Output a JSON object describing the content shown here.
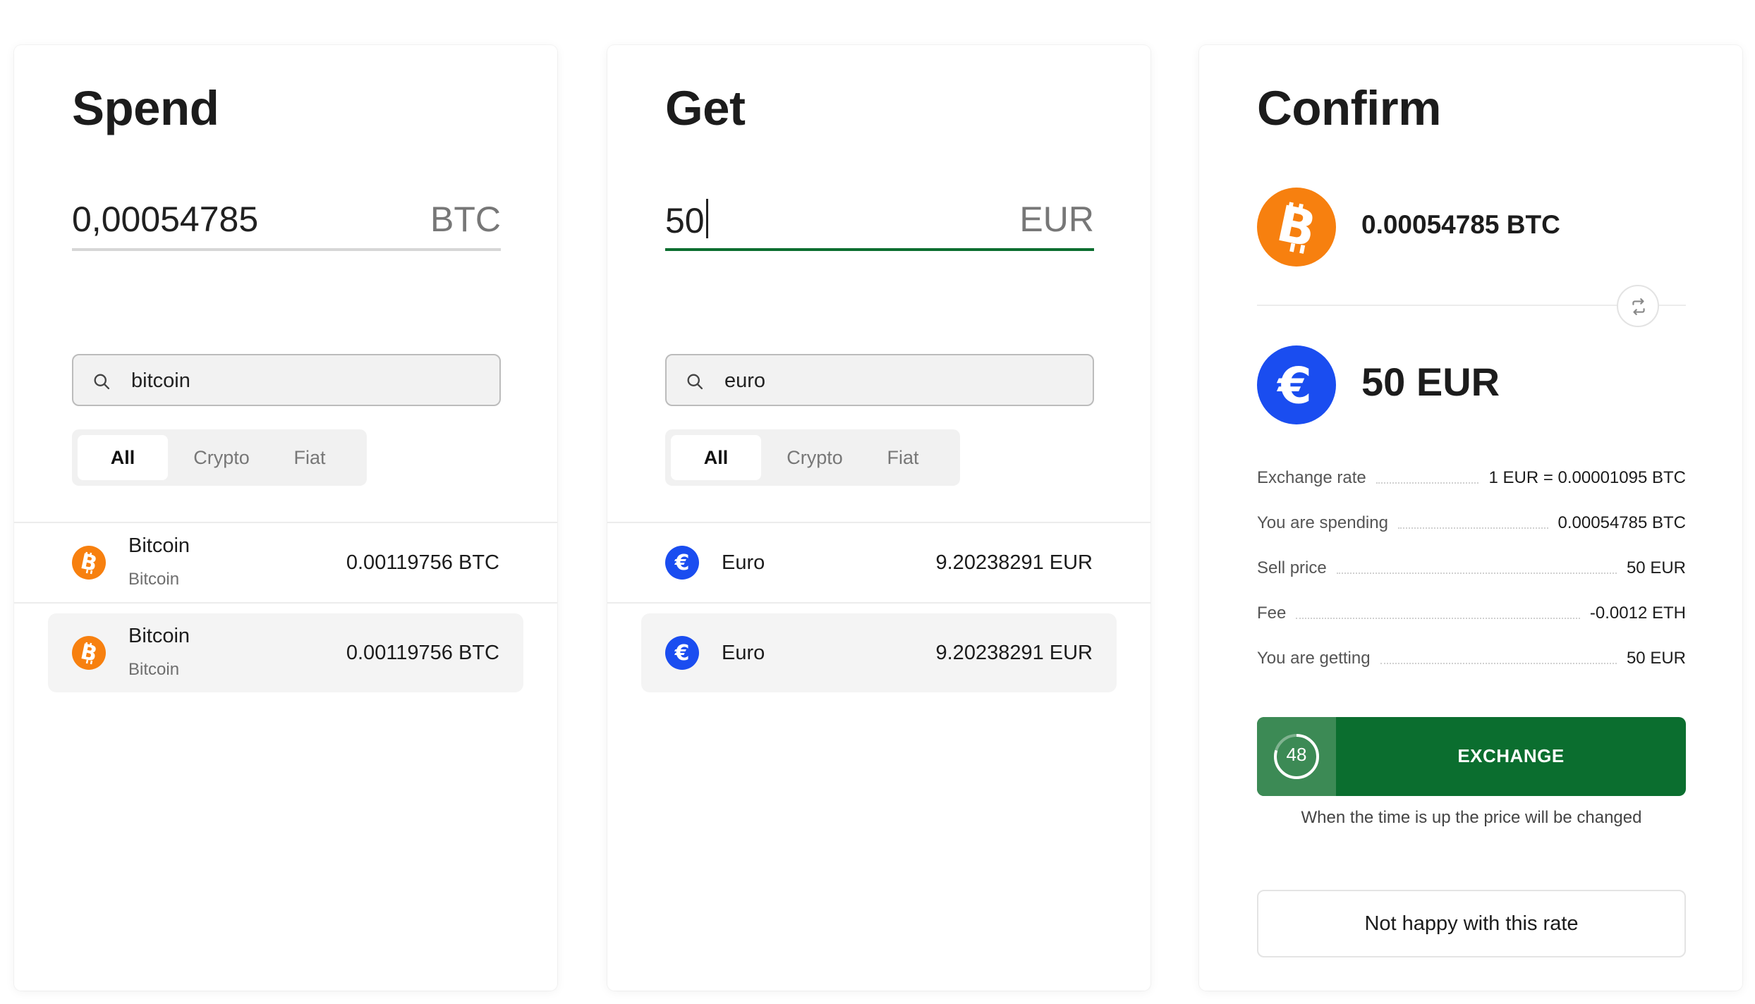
{
  "colors": {
    "accent_green": "#0b6e2f",
    "timer_green": "#3c8a55",
    "bitcoin_orange": "#f7800f",
    "euro_blue": "#1a4df0"
  },
  "spend": {
    "title": "Spend",
    "amount": "0,00054785",
    "currency": "BTC",
    "search_value": "bitcoin",
    "search_icon": "search-icon",
    "tabs": [
      "All",
      "Crypto",
      "Fiat"
    ],
    "active_tab": "All",
    "results": [
      {
        "name": "Bitcoin",
        "subtitle": "Bitcoin",
        "amount": "0.00119756 BTC",
        "icon": "bitcoin-icon"
      },
      {
        "name": "Bitcoin",
        "subtitle": "Bitcoin",
        "amount": "0.00119756 BTC",
        "icon": "bitcoin-icon"
      }
    ]
  },
  "get": {
    "title": "Get",
    "amount": "50",
    "currency": "EUR",
    "search_value": "euro",
    "search_icon": "search-icon",
    "tabs": [
      "All",
      "Crypto",
      "Fiat"
    ],
    "active_tab": "All",
    "results": [
      {
        "name": "Euro",
        "amount": "9.20238291 EUR",
        "icon": "euro-icon"
      },
      {
        "name": "Euro",
        "amount": "9.20238291 EUR",
        "icon": "euro-icon"
      }
    ]
  },
  "confirm": {
    "title": "Confirm",
    "from_amount": "0.00054785 BTC",
    "from_icon": "bitcoin-icon",
    "to_amount": "50 EUR",
    "to_icon": "euro-icon",
    "swap_icon": "swap-icon",
    "details": [
      {
        "label": "Exchange rate",
        "value": "1 EUR = 0.00001095 BTC"
      },
      {
        "label": "You are spending",
        "value": "0.00054785 BTC"
      },
      {
        "label": "Sell price",
        "value": "50 EUR"
      },
      {
        "label": "Fee",
        "value": "-0.0012 ETH"
      },
      {
        "label": "You are getting",
        "value": "50 EUR"
      }
    ],
    "timer": "48",
    "exchange_label": "EXCHANGE",
    "timer_note": "When the time is up the price will be changed",
    "unhappy_label": "Not happy with this rate"
  }
}
